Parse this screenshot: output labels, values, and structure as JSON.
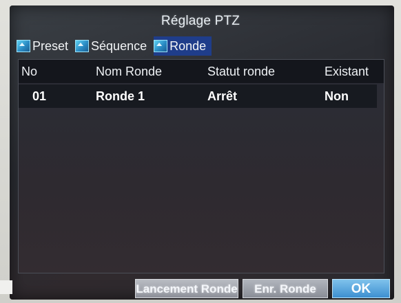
{
  "window": {
    "title": "Réglage PTZ"
  },
  "tabs": [
    {
      "label": "Preset",
      "icon": "camera-icon",
      "active": false
    },
    {
      "label": "Séquence",
      "icon": "camera-icon",
      "active": false
    },
    {
      "label": "Ronde",
      "icon": "camera-icon",
      "active": true
    }
  ],
  "table": {
    "columns": [
      "No",
      "Nom Ronde",
      "Statut ronde",
      "Existant"
    ],
    "rows": [
      {
        "no": "01",
        "nom": "Ronde 1",
        "statut": "Arrêt",
        "existant": "Non"
      }
    ]
  },
  "buttons": {
    "launch_label": "Lancement Ronde",
    "save_label": "Enr. Ronde",
    "ok_label": "OK"
  },
  "colors": {
    "active_tab": "#1f3d8a",
    "ok_button": "#3d8fd0"
  }
}
